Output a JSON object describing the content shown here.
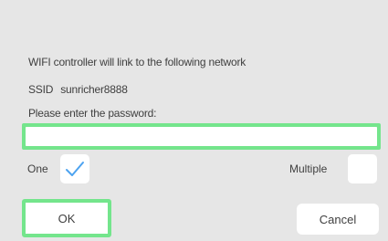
{
  "dialog": {
    "message": "WIFI controller will link to the following network",
    "ssid_label": "SSID",
    "ssid_value": "sunricher8888",
    "prompt": "Please enter the password:",
    "password_value": "",
    "mode": {
      "one_label": "One",
      "one_checked": true,
      "multiple_label": "Multiple",
      "multiple_checked": false
    },
    "buttons": {
      "ok_label": "OK",
      "cancel_label": "Cancel"
    },
    "colors": {
      "highlight": "#74e58c",
      "check": "#4da3f0",
      "background": "#e6e6e6"
    }
  }
}
